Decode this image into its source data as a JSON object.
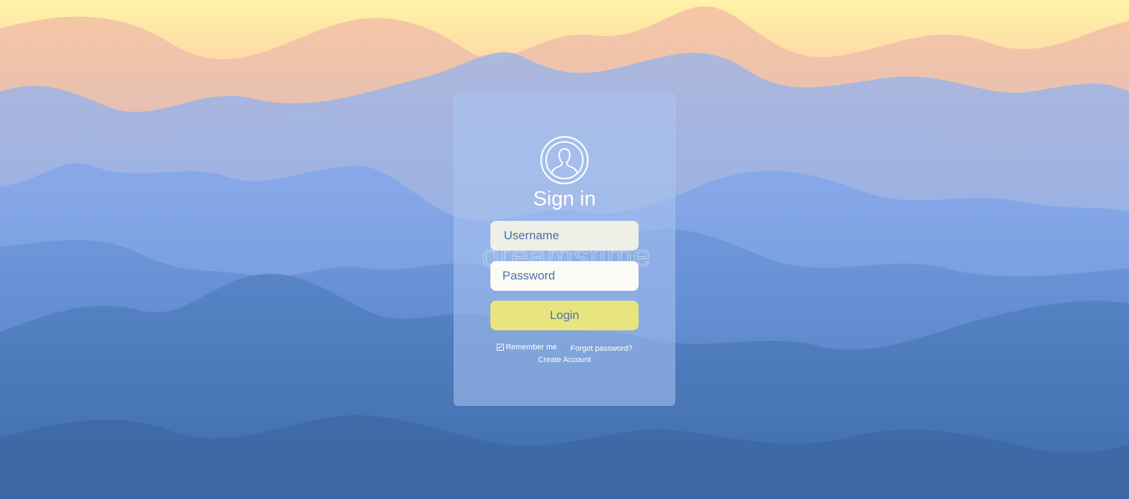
{
  "signin": {
    "title": "Sign in",
    "username_placeholder": "Username",
    "password_placeholder": "Password",
    "login_label": "Login",
    "remember_label": "Remember me",
    "remember_checked": true,
    "forgot_label": "Forgot password?",
    "create_label": "Create Account"
  },
  "watermark": {
    "text": "dreamstime"
  },
  "icons": {
    "avatar": "user-circle-icon",
    "checkbox": "checkbox-checked-icon"
  },
  "colors": {
    "card": "#aac4f0",
    "login_button": "#e8e57e",
    "text_accent": "#4c6fa6",
    "sky_top": "#fff6a8",
    "mountain_deep": "#3f6fae"
  }
}
